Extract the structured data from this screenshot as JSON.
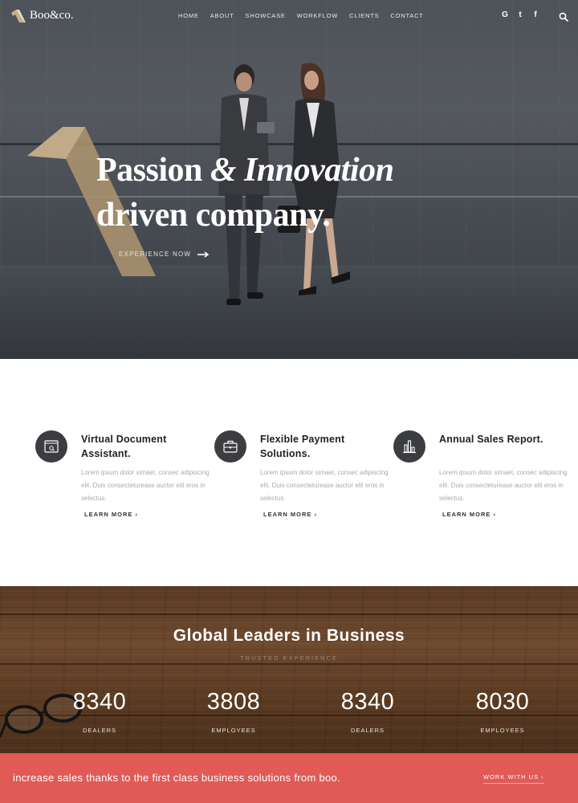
{
  "brand": {
    "name": "Boo&co.",
    "accent": "#b29b7c"
  },
  "nav": {
    "items": [
      "HOME",
      "ABOUT",
      "SHOWCASE",
      "WORKFLOW",
      "CLIENTS",
      "CONTACT"
    ],
    "social": [
      "G",
      "t",
      "f"
    ],
    "social_icons": [
      "google-icon",
      "twitter-icon",
      "facebook-icon"
    ]
  },
  "hero": {
    "line1_a": "Passion ",
    "line1_amp": "& ",
    "line1_b": "Innovation",
    "line2": "driven company.",
    "cta": "EXPERIENCE NOW"
  },
  "features": [
    {
      "icon": "document-icon",
      "title": "Virtual Document Assistant.",
      "text": "Lorem ipsum dolor simaet, consec adipiscing elit. Duis consecteturease auctor elit eros in selectus.",
      "link": "LEARN MORE ›"
    },
    {
      "icon": "briefcase-icon",
      "title": "Flexible Payment Solutions.",
      "text": "Lorem ipsum dolor simaet, consec adipiscing elit. Duis consecteturease auctor elit eros in selectus.",
      "link": "LEARN MORE ›"
    },
    {
      "icon": "bar-chart-icon",
      "title": "Annual Sales Report.",
      "text": "Lorem ipsum dolor simaet, consec adipiscing elit. Duis consecteturease auctor elit eros in selectus.",
      "link": "LEARN MORE ›"
    }
  ],
  "stats": {
    "title": "Global Leaders in Business",
    "subtitle": "TRUSTED EXPERIENCE",
    "items": [
      {
        "value": "8340",
        "label": "DEALERS"
      },
      {
        "value": "3808",
        "label": "EMPLOYEES"
      },
      {
        "value": "8340",
        "label": "DEALERS"
      },
      {
        "value": "8030",
        "label": "EMPLOYEES"
      }
    ]
  },
  "cta_bar": {
    "text": "increase sales thanks to the first class business solutions from boo.",
    "link": "WORK WITH US ›",
    "color": "#e05a56"
  }
}
